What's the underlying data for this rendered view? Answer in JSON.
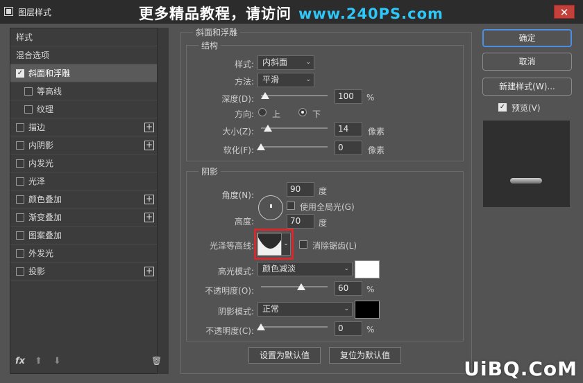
{
  "window": {
    "title": "图层样式",
    "close_glyph": "✕",
    "watermark_text": "更多精品教程，请访问",
    "watermark_url": "www.240PS.com",
    "site_logo": "UiBQ.CoM"
  },
  "styles_panel": {
    "items": [
      {
        "label": "样式",
        "checkbox": null,
        "plus": false,
        "selected": false,
        "sub": false
      },
      {
        "label": "混合选项",
        "checkbox": null,
        "plus": false,
        "selected": false,
        "sub": false
      },
      {
        "label": "斜面和浮雕",
        "checkbox": true,
        "plus": false,
        "selected": true,
        "sub": false
      },
      {
        "label": "等高线",
        "checkbox": false,
        "plus": false,
        "selected": false,
        "sub": true
      },
      {
        "label": "纹理",
        "checkbox": false,
        "plus": false,
        "selected": false,
        "sub": true
      },
      {
        "label": "描边",
        "checkbox": false,
        "plus": true,
        "selected": false,
        "sub": false
      },
      {
        "label": "内阴影",
        "checkbox": false,
        "plus": true,
        "selected": false,
        "sub": false
      },
      {
        "label": "内发光",
        "checkbox": false,
        "plus": false,
        "selected": false,
        "sub": false
      },
      {
        "label": "光泽",
        "checkbox": false,
        "plus": false,
        "selected": false,
        "sub": false
      },
      {
        "label": "颜色叠加",
        "checkbox": false,
        "plus": true,
        "selected": false,
        "sub": false
      },
      {
        "label": "渐变叠加",
        "checkbox": false,
        "plus": true,
        "selected": false,
        "sub": false
      },
      {
        "label": "图案叠加",
        "checkbox": false,
        "plus": false,
        "selected": false,
        "sub": false
      },
      {
        "label": "外发光",
        "checkbox": false,
        "plus": false,
        "selected": false,
        "sub": false
      },
      {
        "label": "投影",
        "checkbox": false,
        "plus": true,
        "selected": false,
        "sub": false
      }
    ],
    "fx_label": "fx",
    "up_arrow": "⬆",
    "down_arrow": "⬇",
    "trash_icon": "🗑"
  },
  "bevel": {
    "section_title": "斜面和浮雕",
    "structure": {
      "title": "结构",
      "style_label": "样式:",
      "style_value": "内斜面",
      "method_label": "方法:",
      "method_value": "平滑",
      "depth_label": "深度(D):",
      "depth_value": "100",
      "depth_unit": "%",
      "depth_fraction": 0.06,
      "direction_label": "方向:",
      "direction_up": "上",
      "direction_down": "下",
      "direction_selected": "下",
      "size_label": "大小(Z):",
      "size_value": "14",
      "size_unit": "像素",
      "size_fraction": 0.1,
      "soften_label": "软化(F):",
      "soften_value": "0",
      "soften_unit": "像素",
      "soften_fraction": 0.0
    },
    "shading": {
      "title": "阴影",
      "angle_label": "角度(N):",
      "angle_value": "90",
      "angle_unit": "度",
      "global_light_label": "使用全局光(G)",
      "global_light_checked": false,
      "altitude_label": "高度:",
      "altitude_value": "70",
      "altitude_unit": "度",
      "gloss_contour_label": "光泽等高线:",
      "anti_alias_label": "消除锯齿(L)",
      "anti_alias_checked": false,
      "highlight_mode_label": "高光模式:",
      "highlight_mode_value": "颜色减淡",
      "highlight_color": "#ffffff",
      "highlight_opacity_label": "不透明度(O):",
      "highlight_opacity_value": "60",
      "highlight_opacity_unit": "%",
      "highlight_opacity_fraction": 0.6,
      "shadow_mode_label": "阴影模式:",
      "shadow_mode_value": "正常",
      "shadow_color": "#000000",
      "shadow_opacity_label": "不透明度(C):",
      "shadow_opacity_value": "0",
      "shadow_opacity_unit": "%",
      "shadow_opacity_fraction": 0.0
    },
    "make_default_label": "设置为默认值",
    "reset_default_label": "复位为默认值"
  },
  "actions": {
    "ok_label": "确定",
    "cancel_label": "取消",
    "new_style_label": "新建样式(W)...",
    "preview_label": "预览(V)",
    "preview_checked": true
  }
}
